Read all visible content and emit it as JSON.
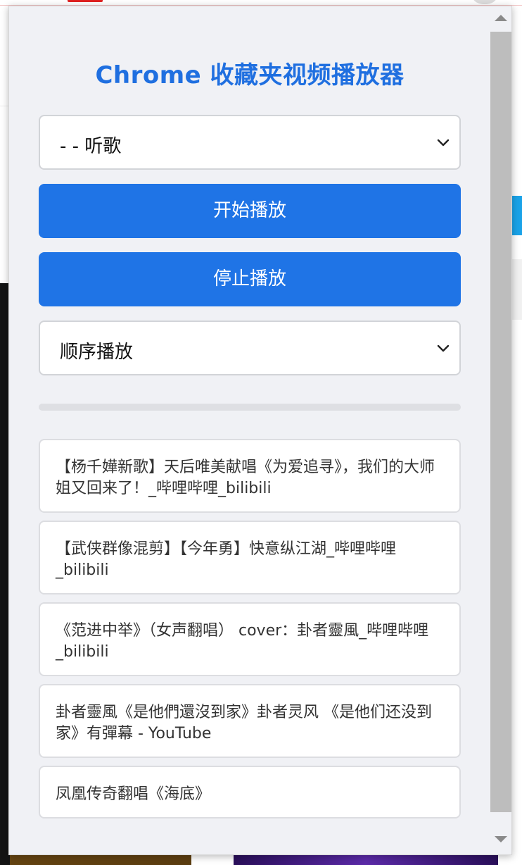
{
  "popup": {
    "title": "Chrome 收藏夹视频播放器",
    "folder_select": {
      "value": "- - 听歌"
    },
    "start_button": "开始播放",
    "stop_button": "停止播放",
    "mode_select": {
      "value": "顺序播放"
    },
    "progress": {
      "fraction": 0
    },
    "videos": [
      {
        "title": "【杨千嬅新歌】天后唯美献唱《为爱追寻》，我们的大师姐又回来了！_哔哩哔哩_bilibili"
      },
      {
        "title": "【武侠群像混剪】【今年勇】快意纵江湖_哔哩哔哩_bilibili"
      },
      {
        "title": "《范进中举》（女声翻唱） cover：卦者靈風_哔哩哔哩_bilibili"
      },
      {
        "title": "卦者靈風《是他們還沒到家》卦者灵风 《是他们还没到家》有彈幕 - YouTube"
      },
      {
        "title": "凤凰传奇翻唱《海底》"
      }
    ]
  },
  "colors": {
    "accent": "#1f74e6",
    "title": "#1f6fe0",
    "panel_bg": "#f0f1f5"
  },
  "icons": {
    "select_arrow": "chevron-down-icon",
    "scroll_up": "scroll-up-arrow-icon",
    "scroll_down": "scroll-down-arrow-icon"
  }
}
